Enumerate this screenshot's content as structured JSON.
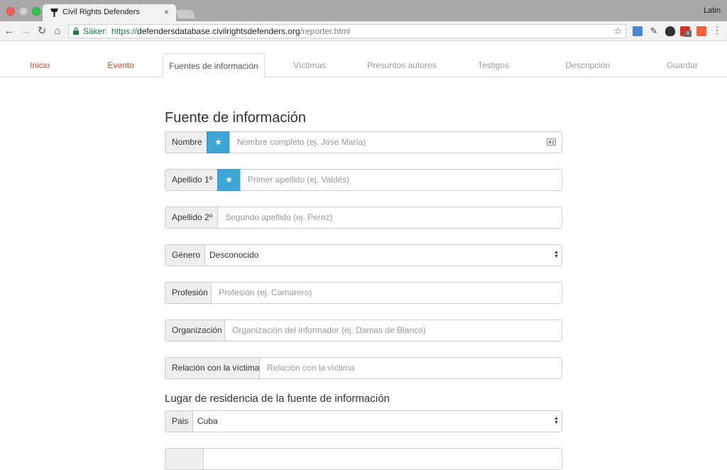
{
  "browser": {
    "tab_title": "Civil Rights Defenders",
    "close_glyph": "×",
    "profile_name": "Latin",
    "secure_label": "Säker",
    "url_scheme": "https://",
    "url_host": "defendersdatabase.civilrightsdefenders.org",
    "url_path": "/reporter.html",
    "extension_badge": "6",
    "icons": [
      "back-icon",
      "forward-icon",
      "reload-icon",
      "home-icon",
      "lock-icon",
      "bookmark-star-icon",
      "menu-icon"
    ]
  },
  "nav": {
    "tabs": [
      {
        "label": "Inicio",
        "state": "done"
      },
      {
        "label": "Evento",
        "state": "done"
      },
      {
        "label": "Fuentes de información",
        "state": "active"
      },
      {
        "label": "Víctimas",
        "state": "future"
      },
      {
        "label": "Presuntos autores",
        "state": "future"
      },
      {
        "label": "Testigos",
        "state": "future"
      },
      {
        "label": "Descripción",
        "state": "future"
      },
      {
        "label": "Guardar",
        "state": "future"
      }
    ]
  },
  "form": {
    "title": "Fuente de información",
    "required_glyph": "★",
    "fields": {
      "nombre": {
        "label": "Nombre",
        "placeholder": "Nombre completo (ej. Jose María)"
      },
      "apellido1": {
        "label": "Apellido 1º",
        "placeholder": "Primer apellido (ej. Valdés)"
      },
      "apellido2": {
        "label": "Apellido 2º",
        "placeholder": "Segundo apellido (ej. Perez)"
      },
      "genero": {
        "label": "Género",
        "value": "Desconocido"
      },
      "profesion": {
        "label": "Profesión",
        "placeholder": "Profesión (ej. Camarero)"
      },
      "organizacion": {
        "label": "Organización",
        "placeholder": "Organización del informador (ej. Damas de Blanco)"
      },
      "relacion": {
        "label": "Relación con la víctima",
        "placeholder": "Relación con la víctima"
      }
    },
    "residence_title": "Lugar de residencia de la fuente de información",
    "pais": {
      "label": "Pais",
      "value": "Cuba"
    }
  },
  "colors": {
    "accent_done": "#d9472b",
    "required_badge": "#3ea6d6"
  }
}
